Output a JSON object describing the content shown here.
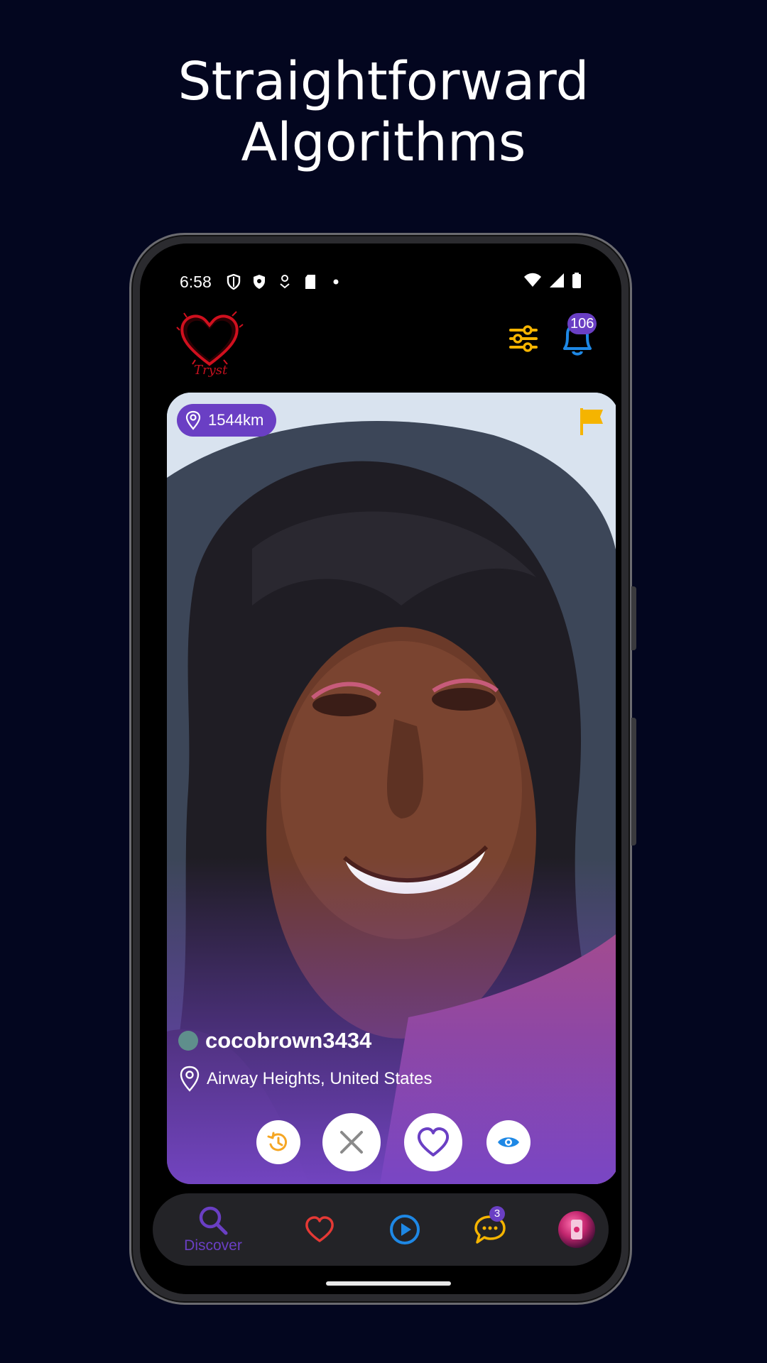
{
  "headline": {
    "line1": "Straightforward",
    "line2": "Algorithms"
  },
  "status_bar": {
    "time": "6:58"
  },
  "app_bar": {
    "notifications_count": "106"
  },
  "profile_card": {
    "distance": "1544km",
    "username": "cocobrown3434",
    "location": "Airway Heights, United States"
  },
  "bottom_nav": {
    "discover_label": "Discover",
    "chat_badge": "3",
    "items": [
      "discover",
      "likes",
      "videos",
      "chats",
      "profile"
    ]
  },
  "colors": {
    "background": "#03061f",
    "accent_purple": "#6a3fc4",
    "accent_yellow": "#f5b400",
    "accent_blue": "#1e88e5",
    "accent_red": "#e53935"
  }
}
